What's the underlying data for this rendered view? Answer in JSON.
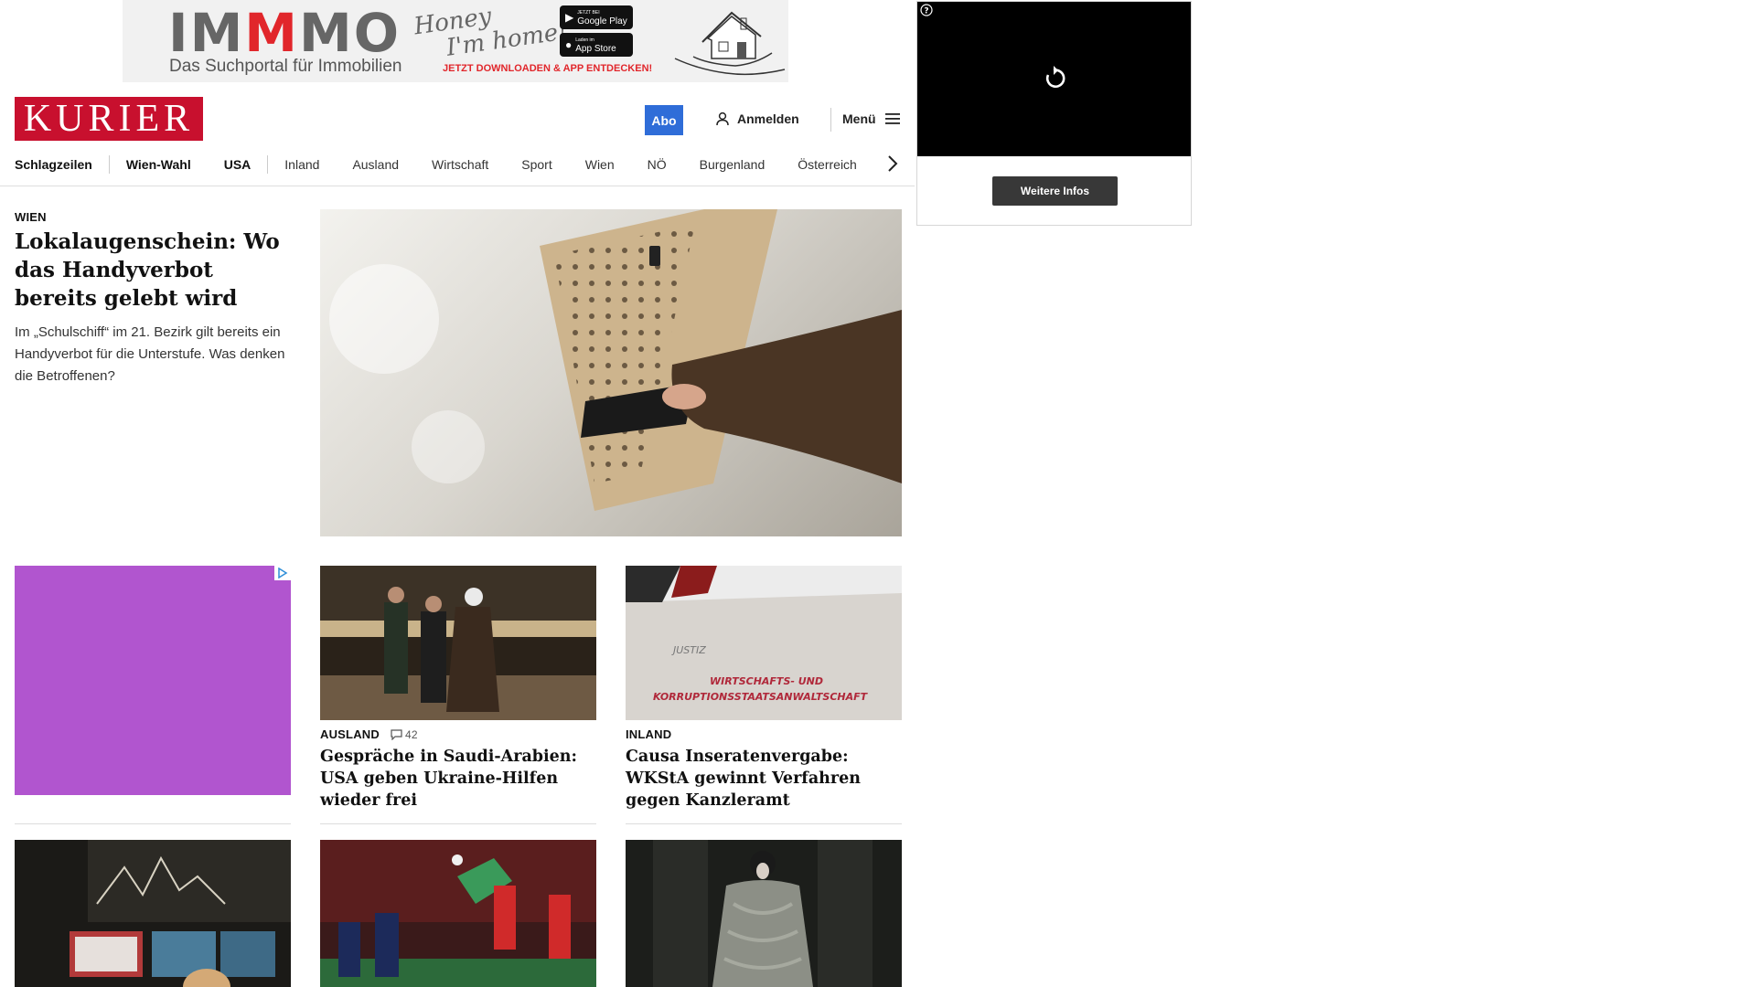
{
  "banner": {
    "brand_prefix": "IM",
    "brand_red": "M",
    "brand_suffix": "MO",
    "subtitle": "Das Suchportal für Immobilien",
    "tagline_line1": "Honey",
    "tagline_line2": "I'm home!",
    "google_small": "JETZT BEI",
    "google_label": "Google Play",
    "apple_small": "Laden im",
    "apple_label": "App Store",
    "cta": "JETZT DOWNLOADEN & APP ENTDECKEN!",
    "accent_color": "#e1262b"
  },
  "header": {
    "logo": "KURIER",
    "logo_color": "#c8102e",
    "abo_label": "Abo",
    "abo_color": "#2f6dd8",
    "login_label": "Anmelden",
    "menu_label": "Menü"
  },
  "nav": {
    "items": [
      "Schlagzeilen",
      "Wien-Wahl",
      "USA",
      "Inland",
      "Ausland",
      "Wirtschaft",
      "Sport",
      "Wien",
      "NÖ",
      "Burgenland",
      "Österreich"
    ]
  },
  "lead": {
    "kicker": "WIEN",
    "title": "Lokalaugenschein: Wo das Handyverbot bereits gelebt wird",
    "teaser": "Im „Schulschiff“ im 21. Bezirk gilt bereits ein Handyverbot für die Unterstufe. Was denken die Betroffenen?"
  },
  "cards": [
    {
      "kicker": "AUSLAND",
      "comments": "42",
      "title": "Gespräche in Saudi-Arabien: USA geben Ukraine-Hilfen wieder frei"
    },
    {
      "kicker": "INLAND",
      "title": "Causa Inseratenvergabe: WKStA gewinnt Verfahren gegen Kanzleramt",
      "image_text_small": "JUSTIZ",
      "image_text_line1": "WIRTSCHAFTS- UND",
      "image_text_line2": "KORRUPTIONSSTAATSANWALTSCHAFT"
    }
  ],
  "ad_colors": {
    "purple": "#b155cf"
  },
  "video_ad": {
    "button_label": "Weitere Infos"
  }
}
